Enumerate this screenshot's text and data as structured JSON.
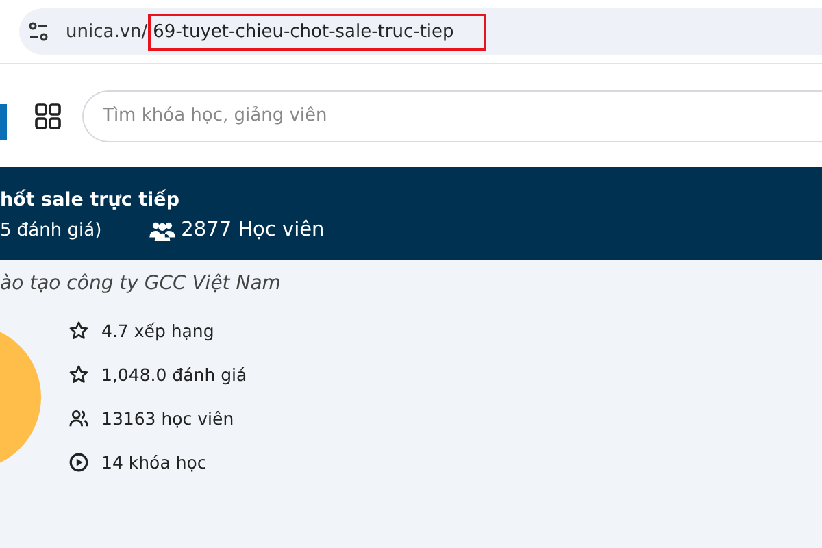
{
  "address_bar": {
    "domain": "unica.vn/",
    "path": "69-tuyet-chieu-chot-sale-truc-tiep",
    "path_highlighted": true
  },
  "search": {
    "placeholder": "Tìm khóa học, giảng viên"
  },
  "banner": {
    "title": "hốt sale trực tiếp",
    "rating_text": "5 đánh giá)",
    "students": "2877 Học viên"
  },
  "instructor": {
    "subtitle": "ào tạo công ty GCC Việt Nam",
    "stats": [
      {
        "kind": "star",
        "text": "4.7 xếp hạng"
      },
      {
        "kind": "star",
        "text": "1,048.0 đánh giá"
      },
      {
        "kind": "people",
        "text": "13163 học viên"
      },
      {
        "kind": "play",
        "text": "14 khóa học"
      }
    ]
  }
}
